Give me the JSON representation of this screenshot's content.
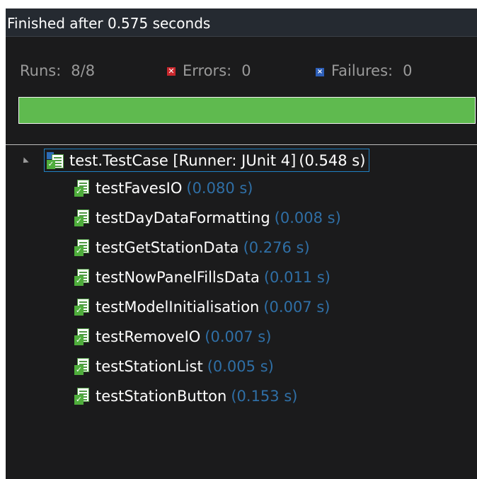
{
  "status": {
    "text": "Finished after 0.575 seconds"
  },
  "counters": {
    "runs_label": "Runs:",
    "runs_value": "8/8",
    "errors_label": "Errors:",
    "errors_value": "0",
    "failures_label": "Failures:",
    "failures_value": "0"
  },
  "progress": {
    "fraction": 1.0,
    "color": "#5fba4f"
  },
  "tree": {
    "root": {
      "name": "test.TestCase [Runner: JUnit 4]",
      "time": "(0.548 s)",
      "icon": "test-suite-success-icon"
    },
    "tests": [
      {
        "name": "testFavesIO",
        "time": "(0.080 s)",
        "icon": "test-success-icon"
      },
      {
        "name": "testDayDataFormatting",
        "time": "(0.008 s)",
        "icon": "test-success-icon"
      },
      {
        "name": "testGetStationData",
        "time": "(0.276 s)",
        "icon": "test-success-icon"
      },
      {
        "name": "testNowPanelFillsData",
        "time": "(0.011 s)",
        "icon": "test-success-icon"
      },
      {
        "name": "testModelInitialisation",
        "time": "(0.007 s)",
        "icon": "test-success-icon"
      },
      {
        "name": "testRemoveIO",
        "time": "(0.007 s)",
        "icon": "test-success-icon"
      },
      {
        "name": "testStationList",
        "time": "(0.005 s)",
        "icon": "test-success-icon"
      },
      {
        "name": "testStationButton",
        "time": "(0.153 s)",
        "icon": "test-success-icon"
      }
    ]
  },
  "colors": {
    "background": "#1b1b1c",
    "test_time": "#2f6fa6",
    "selection_border": "#1f80c2",
    "error_icon": "#c9282d",
    "failure_icon": "#2d5fb8"
  }
}
